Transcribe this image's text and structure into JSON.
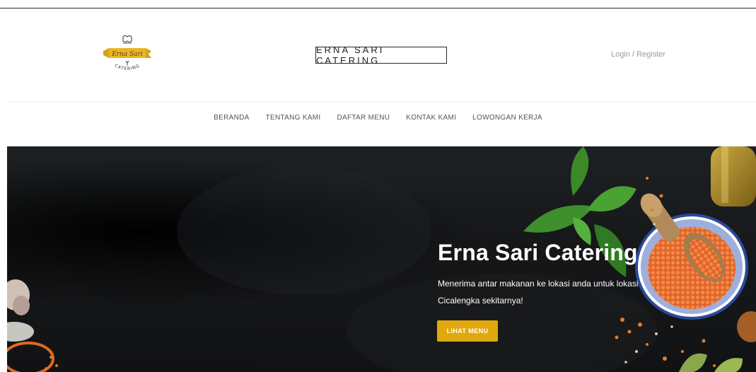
{
  "header": {
    "logo_name": "Erna Sari",
    "logo_ribbon": "CATERING",
    "brand_title": "ERNA SARI CATERING",
    "login_label": "Login / Register"
  },
  "nav": {
    "items": [
      {
        "label": "BERANDA"
      },
      {
        "label": "TENTANG KAMI"
      },
      {
        "label": "DAFTAR MENU"
      },
      {
        "label": "KONTAK KAMI"
      },
      {
        "label": "LOWONGAN KERJA"
      }
    ]
  },
  "hero": {
    "title": "Erna Sari Catering",
    "subtitle": "Menerima antar makanan ke lokasi anda untuk lokasi Cicalengka sekitarnya!",
    "button_label": "LIHAT MENU"
  },
  "colors": {
    "accent": "#e0a80d",
    "hero_bg": "#17191b",
    "lentil": "#e56a2c",
    "basil": "#3f8f2c"
  }
}
